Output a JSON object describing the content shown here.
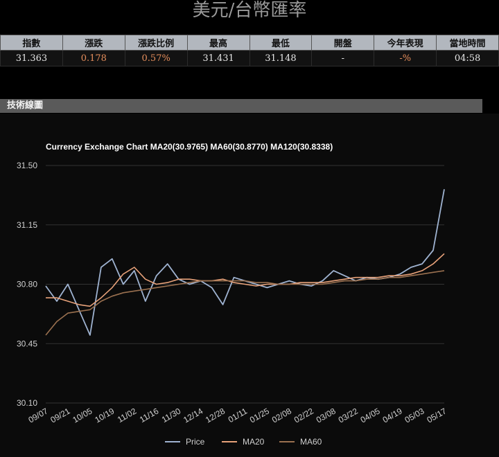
{
  "page": {
    "title": "美元/台幣匯率"
  },
  "quote_table": {
    "headers": [
      "指數",
      "漲跌",
      "漲跌比例",
      "最高",
      "最低",
      "開盤",
      "今年表現",
      "當地時間"
    ],
    "values": [
      "31.363",
      "0.178",
      "0.57%",
      "31.431",
      "31.148",
      "-",
      "-%",
      "04:58"
    ]
  },
  "section": {
    "title": "技術線圖"
  },
  "colors": {
    "price": "#9fb3d1",
    "ma20": "#e8a27a",
    "ma60": "#9b7150",
    "up": "#e58e5c"
  },
  "chart_data": {
    "type": "line",
    "title": "Currency Exchange Chart MA20(30.9765) MA60(30.8770) MA120(30.8338)",
    "x": [
      "09/07",
      "09/14",
      "09/21",
      "09/28",
      "10/05",
      "10/12",
      "10/19",
      "10/26",
      "11/02",
      "11/09",
      "11/16",
      "11/23",
      "11/30",
      "12/07",
      "12/14",
      "12/21",
      "12/28",
      "01/04",
      "01/11",
      "01/18",
      "01/25",
      "02/01",
      "02/08",
      "02/15",
      "02/22",
      "03/01",
      "03/08",
      "03/15",
      "03/22",
      "03/29",
      "04/05",
      "04/12",
      "04/19",
      "04/26",
      "05/03",
      "05/10",
      "05/17"
    ],
    "x_tick_labels": [
      "09/07",
      "09/21",
      "10/05",
      "10/19",
      "11/02",
      "11/16",
      "11/30",
      "12/14",
      "12/28",
      "01/11",
      "01/25",
      "02/08",
      "02/22",
      "03/08",
      "03/22",
      "04/05",
      "04/19",
      "05/03",
      "05/17"
    ],
    "ylim": [
      30.1,
      31.5
    ],
    "yticks": [
      "30.10",
      "30.45",
      "30.80",
      "31.15",
      "31.50"
    ],
    "grid": true,
    "legend": "bottom-center",
    "series": [
      {
        "name": "Price",
        "values": [
          30.79,
          30.7,
          30.8,
          30.65,
          30.5,
          30.9,
          30.95,
          30.8,
          30.88,
          30.7,
          30.85,
          30.92,
          30.83,
          30.8,
          30.82,
          30.78,
          30.68,
          30.84,
          30.82,
          30.8,
          30.78,
          30.8,
          30.82,
          30.8,
          30.79,
          30.82,
          30.88,
          30.85,
          30.82,
          30.84,
          30.83,
          30.84,
          30.86,
          30.9,
          30.92,
          31.0,
          31.36
        ]
      },
      {
        "name": "MA20",
        "values": [
          30.72,
          30.72,
          30.7,
          30.68,
          30.67,
          30.72,
          30.78,
          30.86,
          30.9,
          30.83,
          30.8,
          30.81,
          30.83,
          30.83,
          30.82,
          30.82,
          30.83,
          30.81,
          30.8,
          30.79,
          30.8,
          30.8,
          30.8,
          30.81,
          30.81,
          30.81,
          30.82,
          30.83,
          30.84,
          30.84,
          30.84,
          30.85,
          30.85,
          30.86,
          30.88,
          30.92,
          30.98
        ]
      },
      {
        "name": "MA60",
        "values": [
          30.5,
          30.58,
          30.63,
          30.64,
          30.65,
          30.7,
          30.73,
          30.75,
          30.76,
          30.77,
          30.78,
          30.79,
          30.8,
          30.81,
          30.82,
          30.82,
          30.82,
          30.82,
          30.82,
          30.81,
          30.81,
          30.8,
          30.8,
          30.8,
          30.8,
          30.8,
          30.81,
          30.82,
          30.82,
          30.83,
          30.83,
          30.84,
          30.84,
          30.85,
          30.86,
          30.87,
          30.88
        ]
      }
    ]
  }
}
